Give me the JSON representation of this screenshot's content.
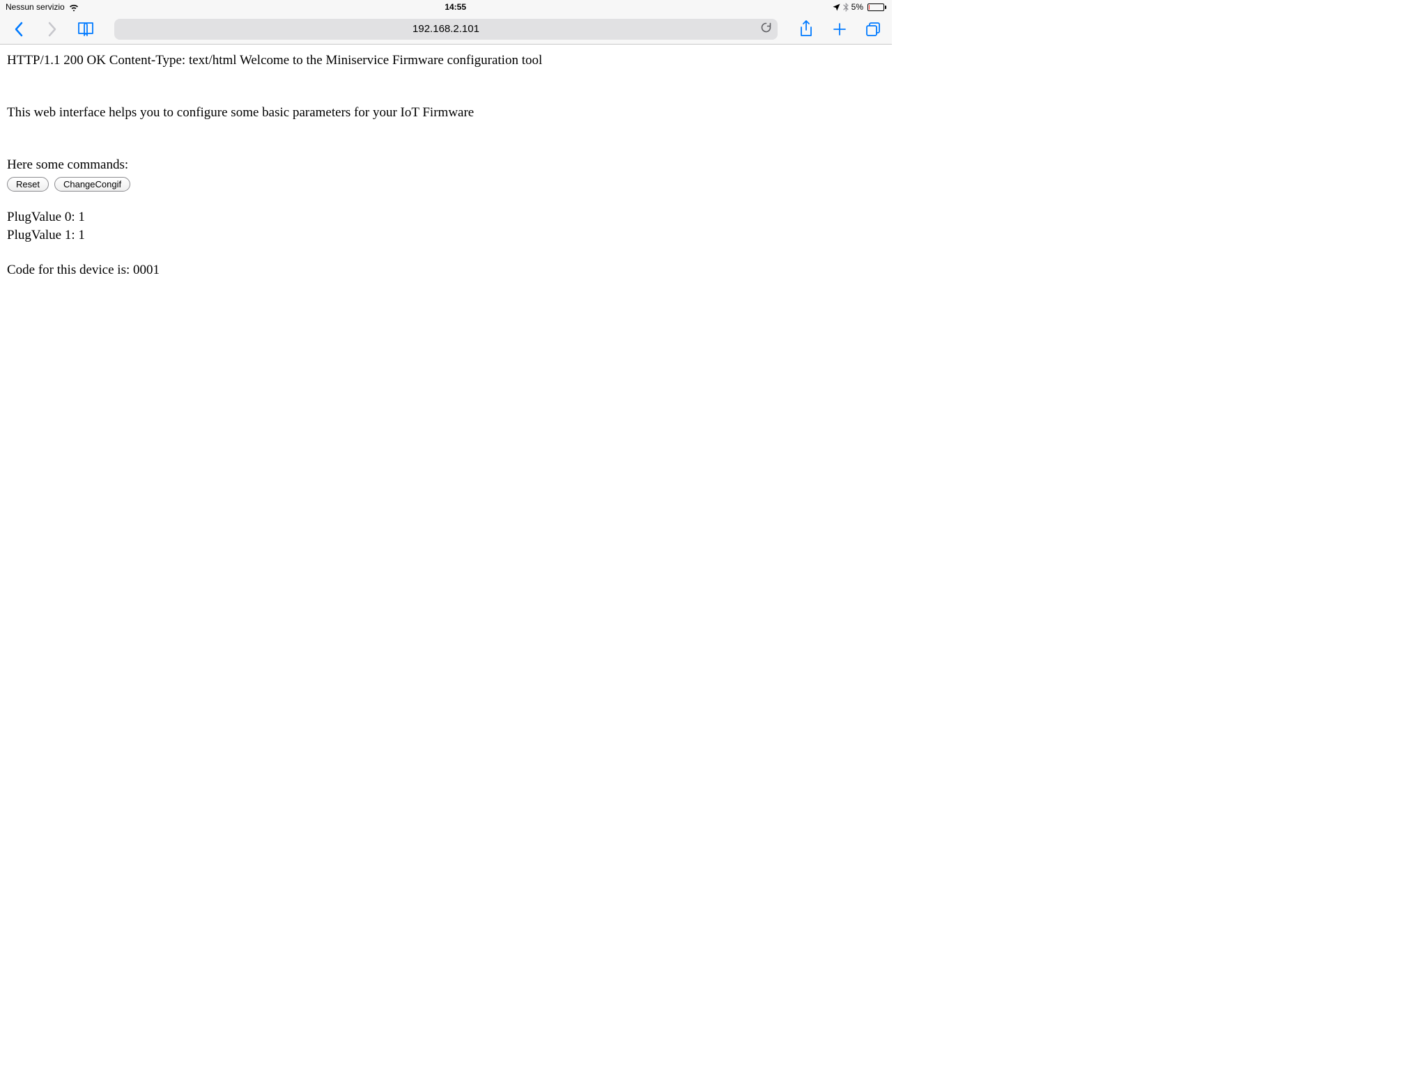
{
  "status_bar": {
    "carrier": "Nessun servizio",
    "time": "14:55",
    "battery_pct": "5%"
  },
  "nav": {
    "url": "192.168.2.101"
  },
  "page": {
    "line1": "HTTP/1.1 200 OK Content-Type: text/html Welcome to the Miniservice Firmware configuration tool",
    "line2": "This web interface helps you to configure some basic parameters for your IoT Firmware",
    "line3": "Here some commands:",
    "btn_reset": "Reset",
    "btn_change": "ChangeCongif",
    "plug0": "PlugValue 0: 1",
    "plug1": "PlugValue 1: 1",
    "code_line": "Code for this device is: 0001"
  }
}
